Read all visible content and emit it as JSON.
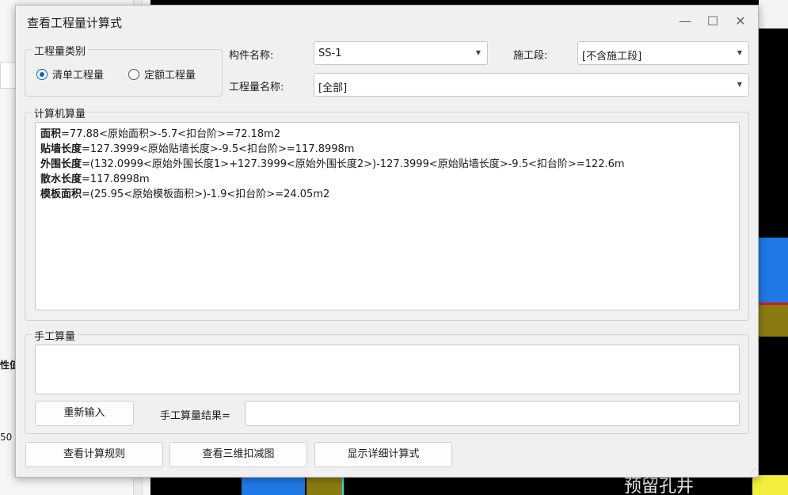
{
  "background": {
    "left_panel": {
      "label": "性值",
      "number": "50"
    },
    "canvas_text": "预留孔井"
  },
  "dialog": {
    "title": "查看工程量计算式",
    "controls": {
      "minimize": "—",
      "maximize": "☐",
      "close": "✕"
    },
    "quantity_type": {
      "legend": "工程量类别",
      "options": [
        {
          "label": "清单工程量",
          "checked": true
        },
        {
          "label": "定额工程量",
          "checked": false
        }
      ]
    },
    "component": {
      "label": "构件名称:",
      "value": "SS-1"
    },
    "construction_section": {
      "label": "施工段:",
      "value": "[不含施工段]"
    },
    "quantity_name": {
      "label": "工程量名称:",
      "value": "[全部]"
    },
    "computer_calc": {
      "legend": "计算机算量",
      "lines": [
        {
          "name": "面积",
          "formula": "=77.88<原始面积>-5.7<扣台阶>=72.18m2"
        },
        {
          "name": "贴墙长度",
          "formula": "=127.3999<原始贴墙长度>-9.5<扣台阶>=117.8998m"
        },
        {
          "name": "外围长度",
          "formula": "=(132.0999<原始外围长度1>+127.3999<原始外围长度2>)-127.3999<原始贴墙长度>-9.5<扣台阶>=122.6m"
        },
        {
          "name": "散水长度",
          "formula": "=117.8998m"
        },
        {
          "name": "模板面积",
          "formula": "=(25.95<原始模板面积>)-1.9<扣台阶>=24.05m2"
        }
      ]
    },
    "manual_calc": {
      "legend": "手工算量",
      "text": "",
      "reenter_button": "重新输入",
      "result_label": "手工算量结果=",
      "result_value": ""
    },
    "buttons": {
      "view_rules": "查看计算规则",
      "view_3d": "查看三维扣减图",
      "show_detail": "显示详细计算式"
    }
  }
}
